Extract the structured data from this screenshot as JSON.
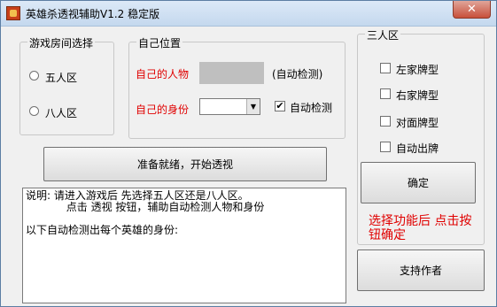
{
  "window": {
    "title": "英雄杀透视辅助V1.2 稳定版",
    "close_label": "✕"
  },
  "room": {
    "group_label": "游戏房间选择",
    "option_five": "五人区",
    "option_eight": "八人区"
  },
  "self": {
    "group_label": "自己位置",
    "character_label": "自己的人物",
    "character_auto": "(自动检测)",
    "identity_label": "自己的身份",
    "identity_value": "",
    "identity_auto_label": "自动检测",
    "identity_auto_checked": true
  },
  "start_button": "准备就绪，开始透视",
  "info": {
    "line1": "说明: 请进入游戏后 先选择五人区还是八人区。",
    "line2": "            点击 透视 按钮，辅助自动检测人物和身份",
    "line3": "以下自动检测出每个英雄的身份:"
  },
  "three": {
    "group_label": "三人区",
    "options": [
      "左家牌型",
      "右家牌型",
      "对面牌型",
      "自动出牌"
    ],
    "confirm_button": "确定",
    "hint": "选择功能后 点击按钮确定"
  },
  "support_button": "支持作者"
}
